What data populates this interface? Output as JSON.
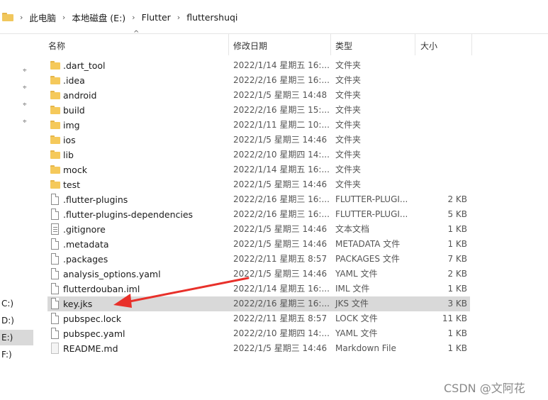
{
  "breadcrumb": {
    "items": [
      "此电脑",
      "本地磁盘 (E:)",
      "Flutter",
      "fluttershuqi"
    ],
    "separator": "›"
  },
  "sidebar": {
    "drives": [
      {
        "label": "C:)",
        "selected": false
      },
      {
        "label": "D:)",
        "selected": false
      },
      {
        "label": "E:)",
        "selected": true
      },
      {
        "label": "F:)",
        "selected": false
      }
    ],
    "pin_glyph": "📌"
  },
  "columns": {
    "sort_indicator": "^",
    "name": "名称",
    "date": "修改日期",
    "type": "类型",
    "size": "大小"
  },
  "files": [
    {
      "name": ".dart_tool",
      "date": "2022/1/14 星期五 16:...",
      "type": "文件夹",
      "size": "",
      "icon": "folder"
    },
    {
      "name": ".idea",
      "date": "2022/2/16 星期三 16:...",
      "type": "文件夹",
      "size": "",
      "icon": "folder"
    },
    {
      "name": "android",
      "date": "2022/1/5 星期三 14:48",
      "type": "文件夹",
      "size": "",
      "icon": "folder"
    },
    {
      "name": "build",
      "date": "2022/2/16 星期三 15:...",
      "type": "文件夹",
      "size": "",
      "icon": "folder"
    },
    {
      "name": "img",
      "date": "2022/1/11 星期二 10:...",
      "type": "文件夹",
      "size": "",
      "icon": "folder"
    },
    {
      "name": "ios",
      "date": "2022/1/5 星期三 14:46",
      "type": "文件夹",
      "size": "",
      "icon": "folder"
    },
    {
      "name": "lib",
      "date": "2022/2/10 星期四 14:...",
      "type": "文件夹",
      "size": "",
      "icon": "folder"
    },
    {
      "name": "mock",
      "date": "2022/1/14 星期五 16:...",
      "type": "文件夹",
      "size": "",
      "icon": "folder"
    },
    {
      "name": "test",
      "date": "2022/1/5 星期三 14:46",
      "type": "文件夹",
      "size": "",
      "icon": "folder"
    },
    {
      "name": ".flutter-plugins",
      "date": "2022/2/16 星期三 16:...",
      "type": "FLUTTER-PLUGI...",
      "size": "2 KB",
      "icon": "file"
    },
    {
      "name": ".flutter-plugins-dependencies",
      "date": "2022/2/16 星期三 16:...",
      "type": "FLUTTER-PLUGI...",
      "size": "5 KB",
      "icon": "file"
    },
    {
      "name": ".gitignore",
      "date": "2022/1/5 星期三 14:46",
      "type": "文本文档",
      "size": "1 KB",
      "icon": "text"
    },
    {
      "name": ".metadata",
      "date": "2022/1/5 星期三 14:46",
      "type": "METADATA 文件",
      "size": "1 KB",
      "icon": "file"
    },
    {
      "name": ".packages",
      "date": "2022/2/11 星期五 8:57",
      "type": "PACKAGES 文件",
      "size": "7 KB",
      "icon": "file"
    },
    {
      "name": "analysis_options.yaml",
      "date": "2022/1/5 星期三 14:46",
      "type": "YAML 文件",
      "size": "2 KB",
      "icon": "file"
    },
    {
      "name": "flutterdouban.iml",
      "date": "2022/1/14 星期五 16:...",
      "type": "IML 文件",
      "size": "1 KB",
      "icon": "file"
    },
    {
      "name": "key.jks",
      "date": "2022/2/16 星期三 16:...",
      "type": "JKS 文件",
      "size": "3 KB",
      "icon": "file",
      "selected": true
    },
    {
      "name": "pubspec.lock",
      "date": "2022/2/11 星期五 8:57",
      "type": "LOCK 文件",
      "size": "11 KB",
      "icon": "file"
    },
    {
      "name": "pubspec.yaml",
      "date": "2022/2/10 星期四 14:...",
      "type": "YAML 文件",
      "size": "1 KB",
      "icon": "file"
    },
    {
      "name": "README.md",
      "date": "2022/1/5 星期三 14:46",
      "type": "Markdown File",
      "size": "1 KB",
      "icon": "md"
    }
  ],
  "annotation": {
    "arrow_color": "#e8302a"
  },
  "watermark": "CSDN @文阿花",
  "colors": {
    "folder": "#f5c95b",
    "selection": "#d9d9d9"
  }
}
